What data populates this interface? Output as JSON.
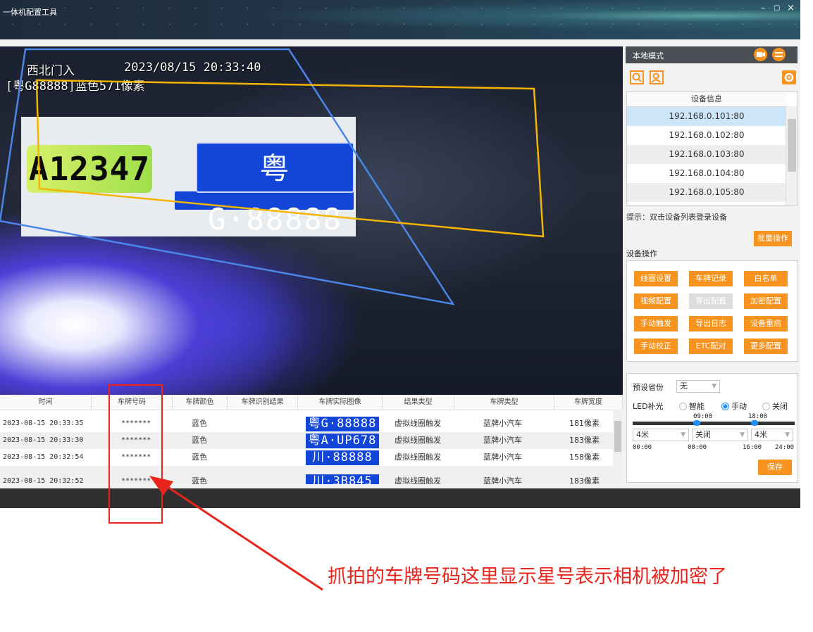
{
  "window": {
    "title": "一体机配置工具",
    "minimize": "–",
    "maximize": "▢",
    "close": "×"
  },
  "overlay": {
    "line1": "西北门入",
    "datetime": "2023/08/15   20:33:40",
    "line2": "[粤G88888]蓝色571像素"
  },
  "scene": {
    "plate_left": "A12347",
    "plate_right": "粤G·88888"
  },
  "right_panel": {
    "mode_label": "本地模式",
    "device_table_header": "设备信息",
    "devices": [
      "192.168.0.101:80",
      "192.168.0.102:80",
      "192.168.0.103:80",
      "192.168.0.104:80",
      "192.168.0.105:80"
    ],
    "hint": "提示：双击设备列表登录设备",
    "batch_button": "批量操作",
    "ops_title": "设备操作",
    "ops_buttons": [
      {
        "label": "线圈设置",
        "disabled": false
      },
      {
        "label": "车牌记录",
        "disabled": false
      },
      {
        "label": "白名单",
        "disabled": false
      },
      {
        "label": "视频配置",
        "disabled": false
      },
      {
        "label": "导出配置",
        "disabled": true
      },
      {
        "label": "加密配置",
        "disabled": false
      },
      {
        "label": "手动触发",
        "disabled": false
      },
      {
        "label": "导出日志",
        "disabled": false
      },
      {
        "label": "设备重启",
        "disabled": false
      },
      {
        "label": "手动校正",
        "disabled": false
      },
      {
        "label": "ETC配对",
        "disabled": false
      },
      {
        "label": "更多配置",
        "disabled": false
      }
    ],
    "province_label": "预设省份",
    "province_value": "无",
    "led_label": "LED补光",
    "led_options": [
      "智能",
      "手动",
      "关闭"
    ],
    "led_selected": "手动",
    "slider_top_labels": [
      "09:00",
      "18:00"
    ],
    "slider_selects": [
      "4米",
      "关闭",
      "4米"
    ],
    "slider_bottom_labels": [
      "00:00",
      "08:00",
      "16:00",
      "24:00"
    ],
    "save_button": "保存"
  },
  "records": {
    "columns": [
      "时间",
      "车牌号码",
      "车牌颜色",
      "车牌识别结果",
      "车牌实际图像",
      "结果类型",
      "车牌类型",
      "车牌宽度"
    ],
    "rows": [
      {
        "time": "2023-08-15 20:33:35",
        "plate": "*******",
        "color": "蓝色",
        "result": "",
        "image": "粤G·88888",
        "type": "虚拟线圈触发",
        "plate_type": "蓝牌小汽车",
        "width": "181像素"
      },
      {
        "time": "2023-08-15 20:33:30",
        "plate": "*******",
        "color": "蓝色",
        "result": "",
        "image": "粤A·UP678",
        "type": "虚拟线圈触发",
        "plate_type": "蓝牌小汽车",
        "width": "183像素"
      },
      {
        "time": "2023-08-15 20:32:54",
        "plate": "*******",
        "color": "蓝色",
        "result": "",
        "image": "川·88888",
        "type": "虚拟线圈触发",
        "plate_type": "蓝牌小汽车",
        "width": "158像素"
      },
      {
        "time": "2023-08-15 20:32:52",
        "plate": "*******",
        "color": "蓝色",
        "result": "",
        "image": "川·3B845",
        "type": "虚拟线圈触发",
        "plate_type": "蓝牌小汽车",
        "width": "183像素"
      }
    ]
  },
  "annotation": {
    "text": "抓拍的车牌号码这里显示星号表示相机被加密了"
  },
  "colors": {
    "accent": "#f7931e",
    "annotation_red": "#e8241c",
    "selection": "#cde6f7",
    "plate_blue": "#1346d8"
  }
}
